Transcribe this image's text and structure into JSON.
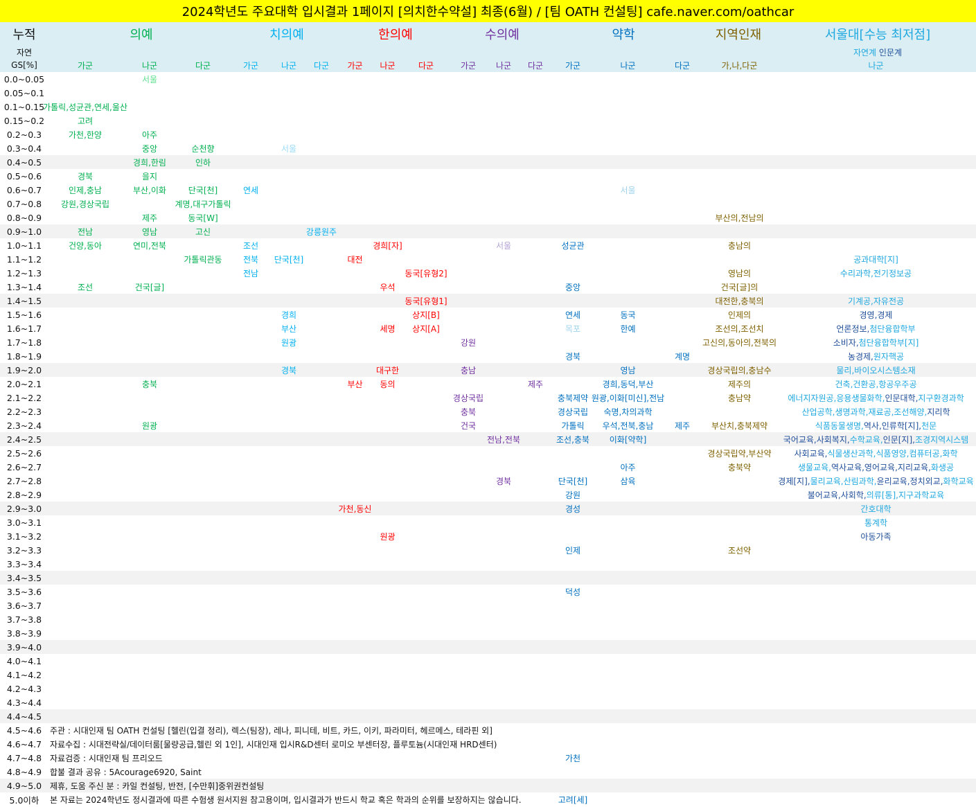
{
  "title": "2024학년도 주요대학 입시결과 1페이지 [의치한수약설] 최종(6월) / [팀 OATH 컨설팅] cafe.naver.com/oathcar",
  "header": {
    "cumulative": "누적",
    "natural": "자연",
    "gs": "GS[%]",
    "groups": {
      "med": "의예",
      "dent": "치의예",
      "kor": "한의예",
      "vet": "수의예",
      "pharm": "약학",
      "reg": "지역인재",
      "snu": "서울대[수능 최저점]"
    },
    "snu_natural": "자연계",
    "snu_humanities": "인문계",
    "sub": {
      "med_ga": "가군",
      "med_na": "나군",
      "med_da": "다군",
      "dent_ga": "가군",
      "dent_na": "나군",
      "dent_da": "다군",
      "kor_ga": "가군",
      "kor_na": "나군",
      "kor_da": "다군",
      "vet_ga": "가군",
      "vet_na": "나군",
      "vet_da": "다군",
      "pharm_ga": "가군",
      "pharm_na": "나군",
      "pharm_da": "다군",
      "reg": "가,나,다군",
      "snu": "나군"
    }
  },
  "colors": {
    "title_bg": "#ffff00",
    "header_bg": "#daeef3",
    "shade": "#f2f2f2",
    "med": "#00b050",
    "dent": "#00b0f0",
    "kor": "#ff0000",
    "vet": "#7030a0",
    "pharm": "#0070c0",
    "reg": "#7f6000",
    "snu_natural": "#1fa8e0",
    "snu_humanities": "#1f4e9a"
  },
  "rows": [
    {
      "gs": "0.0~0.05",
      "cells": {
        "med_na": {
          "t": "서울",
          "faded": true
        }
      }
    },
    {
      "gs": "0.05~0.1",
      "cells": {}
    },
    {
      "gs": "0.1~0.15",
      "cells": {
        "med_ga": {
          "t": "가톨릭,성균관,연세,울산"
        }
      }
    },
    {
      "gs": "0.15~0.2",
      "cells": {
        "med_ga": {
          "t": "고려"
        }
      }
    },
    {
      "gs": "0.2~0.3",
      "cells": {
        "med_ga": {
          "t": "가천,한양"
        },
        "med_na": {
          "t": "아주"
        }
      }
    },
    {
      "gs": "0.3~0.4",
      "cells": {
        "med_na": {
          "t": "중앙"
        },
        "med_da": {
          "t": "순천향"
        },
        "dent_na": {
          "t": "서울",
          "faded": true
        }
      }
    },
    {
      "gs": "0.4~0.5",
      "cells": {
        "med_na": {
          "t": "경희,한림"
        },
        "med_da": {
          "t": "인하"
        }
      }
    },
    {
      "gs": "0.5~0.6",
      "cells": {
        "med_ga": {
          "t": "경북"
        },
        "med_na": {
          "t": "을지"
        }
      }
    },
    {
      "gs": "0.6~0.7",
      "cells": {
        "med_ga": {
          "t": "인제,충남"
        },
        "med_na": {
          "t": "부산,이화"
        },
        "med_da": {
          "t": "단국[천]"
        },
        "dent_ga": {
          "t": "연세"
        },
        "pharm_na": {
          "t": "서울",
          "faded": true
        }
      }
    },
    {
      "gs": "0.7~0.8",
      "cells": {
        "med_ga": {
          "t": "강원,경상국립"
        },
        "med_da": {
          "t": "계명,대구가톨릭"
        }
      }
    },
    {
      "gs": "0.8~0.9",
      "cells": {
        "med_na": {
          "t": "제주"
        },
        "med_da": {
          "t": "동국[W]"
        },
        "reg": {
          "t": "부산의,전남의"
        }
      }
    },
    {
      "gs": "0.9~1.0",
      "cells": {
        "med_ga": {
          "t": "전남"
        },
        "med_na": {
          "t": "영남"
        },
        "med_da": {
          "t": "고신"
        },
        "dent_da": {
          "t": "강릉원주"
        }
      }
    },
    {
      "gs": "1.0~1.1",
      "cells": {
        "med_ga": {
          "t": "건양,동아"
        },
        "med_na": {
          "t": "연미,전북"
        },
        "dent_ga": {
          "t": "조선"
        },
        "kor_na": {
          "t": "경희[자]"
        },
        "vet_na": {
          "t": "서울",
          "faded": true
        },
        "pharm_ga": {
          "t": "성균관"
        },
        "reg": {
          "t": "충남의"
        }
      }
    },
    {
      "gs": "1.1~1.2",
      "cells": {
        "med_da": {
          "t": "가톨릭관동"
        },
        "dent_ga": {
          "t": "전북"
        },
        "dent_na": {
          "t": "단국[천]"
        },
        "kor_ga": {
          "t": "대전"
        },
        "snu": [
          {
            "t": "공과대학[지]",
            "k": "n"
          }
        ]
      }
    },
    {
      "gs": "1.2~1.3",
      "cells": {
        "dent_ga": {
          "t": "전남"
        },
        "kor_da": {
          "t": "동국[유형2]"
        },
        "reg": {
          "t": "영남의"
        },
        "snu": [
          {
            "t": "수리과학,전기정보공",
            "k": "n"
          }
        ]
      }
    },
    {
      "gs": "1.3~1.4",
      "cells": {
        "med_ga": {
          "t": "조선"
        },
        "med_na": {
          "t": "건국[글]"
        },
        "kor_na": {
          "t": "우석"
        },
        "pharm_ga": {
          "t": "중앙"
        },
        "reg": {
          "t": "건국[글]의"
        }
      }
    },
    {
      "gs": "1.4~1.5",
      "cells": {
        "kor_da": {
          "t": "동국[유형1]"
        },
        "reg": {
          "t": "대전한,충북의"
        },
        "snu": [
          {
            "t": "기계공,자유전공",
            "k": "n"
          }
        ]
      }
    },
    {
      "gs": "1.5~1.6",
      "cells": {
        "dent_na": {
          "t": "경희"
        },
        "kor_da": {
          "t": "상지[B]"
        },
        "pharm_ga": {
          "t": "연세"
        },
        "pharm_na": {
          "t": "동국"
        },
        "reg": {
          "t": "인제의"
        },
        "snu": [
          {
            "t": "경영,경제",
            "k": "h"
          }
        ]
      }
    },
    {
      "gs": "1.6~1.7",
      "cells": {
        "dent_na": {
          "t": "부산"
        },
        "kor_na": {
          "t": "세명"
        },
        "kor_da": {
          "t": "상지[A]"
        },
        "pharm_ga": {
          "t": "목포",
          "faded": true
        },
        "pharm_na": {
          "t": "한예"
        },
        "reg": {
          "t": "조선의,조선치"
        },
        "snu": [
          {
            "t": "언론정보,",
            "k": "h"
          },
          {
            "t": "첨단융합학부",
            "k": "n"
          }
        ]
      }
    },
    {
      "gs": "1.7~1.8",
      "cells": {
        "dent_na": {
          "t": "원광"
        },
        "vet_ga": {
          "t": "강원"
        },
        "reg": {
          "t": "고신의,동아의,전북의"
        },
        "snu": [
          {
            "t": "소비자,",
            "k": "h"
          },
          {
            "t": "첨단융합학부[지]",
            "k": "n"
          }
        ]
      }
    },
    {
      "gs": "1.8~1.9",
      "cells": {
        "pharm_ga": {
          "t": "경북"
        },
        "pharm_da": {
          "t": "계명"
        },
        "snu": [
          {
            "t": "농경제,",
            "k": "h"
          },
          {
            "t": "원자핵공",
            "k": "n"
          }
        ]
      }
    },
    {
      "gs": "1.9~2.0",
      "cells": {
        "dent_na": {
          "t": "경북"
        },
        "kor_na": {
          "t": "대구한"
        },
        "vet_ga": {
          "t": "충남"
        },
        "pharm_na": {
          "t": "영남"
        },
        "reg": {
          "t": "경상국립의,충남수"
        },
        "snu": [
          {
            "t": "물리,바이오시스템소재",
            "k": "n"
          }
        ]
      }
    },
    {
      "gs": "2.0~2.1",
      "cells": {
        "med_na": {
          "t": "충북"
        },
        "kor_ga": {
          "t": "부산"
        },
        "kor_na": {
          "t": "동의"
        },
        "vet_da": {
          "t": "제주"
        },
        "pharm_na": {
          "t": "경희,동덕,부산"
        },
        "reg": {
          "t": "제주의"
        },
        "snu": [
          {
            "t": "건축,건환공,항공우주공",
            "k": "n"
          }
        ]
      }
    },
    {
      "gs": "2.1~2.2",
      "cells": {
        "vet_ga": {
          "t": "경상국립"
        },
        "pharm_ga": {
          "t": "충북제약"
        },
        "pharm_na": {
          "t": "원광,이화[미신],전남"
        },
        "reg": {
          "t": "충남약"
        },
        "snu": [
          {
            "t": "에너지자원공,응용생물화학,",
            "k": "n"
          },
          {
            "t": "인문대학,",
            "k": "h"
          },
          {
            "t": "지구환경과학",
            "k": "n"
          }
        ]
      }
    },
    {
      "gs": "2.2~2.3",
      "cells": {
        "vet_ga": {
          "t": "충북"
        },
        "pharm_ga": {
          "t": "경상국립"
        },
        "pharm_na": {
          "t": "숙명,차의과학"
        },
        "snu": [
          {
            "t": "산업공학,생명과학,재료공,조선해양,",
            "k": "n"
          },
          {
            "t": "지리학",
            "k": "h"
          }
        ]
      }
    },
    {
      "gs": "2.3~2.4",
      "cells": {
        "med_na": {
          "t": "원광"
        },
        "vet_ga": {
          "t": "건국"
        },
        "pharm_ga": {
          "t": "가톨릭"
        },
        "pharm_na": {
          "t": "우석,전북,충남"
        },
        "pharm_da": {
          "t": "제주"
        },
        "reg": {
          "t": "부산치,충북제약"
        },
        "snu": [
          {
            "t": "식품동물생명,",
            "k": "n"
          },
          {
            "t": "역사,인류학[지],",
            "k": "h"
          },
          {
            "t": "천문",
            "k": "n"
          }
        ]
      }
    },
    {
      "gs": "2.4~2.5",
      "cells": {
        "vet_na": {
          "t": "전남,전북"
        },
        "pharm_ga": {
          "t": "조선,충북"
        },
        "pharm_na": {
          "t": "이화[약학]"
        },
        "snu": [
          {
            "t": "국어교육,사회복지,",
            "k": "h"
          },
          {
            "t": "수학교육,",
            "k": "n"
          },
          {
            "t": "인문[지],",
            "k": "h"
          },
          {
            "t": "조경지역시스템",
            "k": "n"
          }
        ]
      }
    },
    {
      "gs": "2.5~2.6",
      "cells": {
        "reg": {
          "t": "경상국립약,부산약"
        },
        "snu": [
          {
            "t": "사회교육,",
            "k": "h"
          },
          {
            "t": "식물생산과학,식품영양,컴퓨터공,화학",
            "k": "n"
          }
        ]
      }
    },
    {
      "gs": "2.6~2.7",
      "cells": {
        "pharm_na": {
          "t": "아주"
        },
        "reg": {
          "t": "충북약"
        },
        "snu": [
          {
            "t": "생물교육,",
            "k": "n"
          },
          {
            "t": "역사교육,영어교육,지리교육,",
            "k": "h"
          },
          {
            "t": "화생공",
            "k": "n"
          }
        ]
      }
    },
    {
      "gs": "2.7~2.8",
      "cells": {
        "vet_na": {
          "t": "경북"
        },
        "pharm_ga": {
          "t": "단국[천]"
        },
        "pharm_na": {
          "t": "삼육"
        },
        "snu": [
          {
            "t": "경제[지],",
            "k": "h"
          },
          {
            "t": "물리교육,산림과학,",
            "k": "n"
          },
          {
            "t": "윤리교육,정치외교,",
            "k": "h"
          },
          {
            "t": "화학교육",
            "k": "n"
          }
        ]
      }
    },
    {
      "gs": "2.8~2.9",
      "cells": {
        "pharm_ga": {
          "t": "강원"
        },
        "snu": [
          {
            "t": "불어교육,사회학,",
            "k": "h"
          },
          {
            "t": "의류[통],지구과학교육",
            "k": "n"
          }
        ]
      }
    },
    {
      "gs": "2.9~3.0",
      "cells": {
        "kor_ga": {
          "t": "가천,동신"
        },
        "pharm_ga": {
          "t": "경성"
        },
        "snu": [
          {
            "t": "간호대학",
            "k": "n"
          }
        ]
      }
    },
    {
      "gs": "3.0~3.1",
      "cells": {
        "snu": [
          {
            "t": "통계학",
            "k": "n"
          }
        ]
      }
    },
    {
      "gs": "3.1~3.2",
      "cells": {
        "kor_na": {
          "t": "원광"
        },
        "snu": [
          {
            "t": "아동가족",
            "k": "h"
          }
        ]
      }
    },
    {
      "gs": "3.2~3.3",
      "cells": {
        "pharm_ga": {
          "t": "인제"
        },
        "reg": {
          "t": "조선약"
        }
      }
    },
    {
      "gs": "3.3~3.4",
      "cells": {}
    },
    {
      "gs": "3.4~3.5",
      "cells": {}
    },
    {
      "gs": "3.5~3.6",
      "cells": {
        "pharm_ga": {
          "t": "덕성"
        }
      }
    },
    {
      "gs": "3.6~3.7",
      "cells": {}
    },
    {
      "gs": "3.7~3.8",
      "cells": {}
    },
    {
      "gs": "3.8~3.9",
      "cells": {}
    },
    {
      "gs": "3.9~4.0",
      "cells": {}
    },
    {
      "gs": "4.0~4.1",
      "cells": {}
    },
    {
      "gs": "4.1~4.2",
      "cells": {}
    },
    {
      "gs": "4.2~4.3",
      "cells": {}
    },
    {
      "gs": "4.3~4.4",
      "cells": {}
    },
    {
      "gs": "4.4~4.5",
      "cells": {}
    },
    {
      "gs": "4.5~4.6",
      "cells": {},
      "note": "주관 : 시대인재 팀 OATH 컨설팅 [헬린(입결 정리), 렉스(팀장), 레나, 피니테, 비트, 카드, 이키, 파라미터, 헤르메스, 테라핀 외]"
    },
    {
      "gs": "4.6~4.7",
      "cells": {},
      "note": "자료수집 : 시대전략실/데이터룸[물량공급,헬린 외 1인], 시대인재 입시R&D센터 로미오 부센터장, 플루토늄(시대인재 HRD센터)"
    },
    {
      "gs": "4.7~4.8",
      "cells": {
        "pharm_ga": {
          "t": "가천"
        }
      },
      "note": "자료검증 : 시대인재 팀 프리오드"
    },
    {
      "gs": "4.8~4.9",
      "cells": {},
      "note": "합불 결과 공유 : 5Acourage6920, Saint"
    },
    {
      "gs": "4.9~5.0",
      "cells": {},
      "note": "제휴, 도움 주신 분 : 카일 컨설팅, 반전, [수만휘]중위권컨설팅"
    },
    {
      "gs": "5.0이하",
      "cells": {
        "pharm_ga": {
          "t": "고려[세]"
        }
      },
      "note": "본 자료는 2024학년도 정시결과에 따른 수험생 원서지원 참고용이며, 입시결과가 반드시 학교 혹은 학과의 순위를 보장하지는 않습니다."
    }
  ]
}
